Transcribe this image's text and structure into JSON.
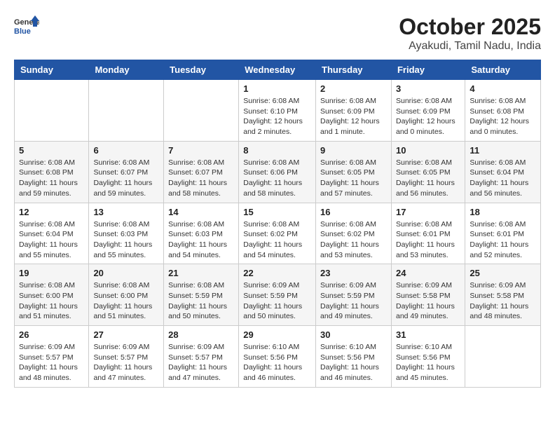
{
  "header": {
    "logo_general": "General",
    "logo_blue": "Blue",
    "month_title": "October 2025",
    "location": "Ayakudi, Tamil Nadu, India"
  },
  "days_of_week": [
    "Sunday",
    "Monday",
    "Tuesday",
    "Wednesday",
    "Thursday",
    "Friday",
    "Saturday"
  ],
  "weeks": [
    [
      {
        "day": "",
        "info": ""
      },
      {
        "day": "",
        "info": ""
      },
      {
        "day": "",
        "info": ""
      },
      {
        "day": "1",
        "info": "Sunrise: 6:08 AM\nSunset: 6:10 PM\nDaylight: 12 hours\nand 2 minutes."
      },
      {
        "day": "2",
        "info": "Sunrise: 6:08 AM\nSunset: 6:09 PM\nDaylight: 12 hours\nand 1 minute."
      },
      {
        "day": "3",
        "info": "Sunrise: 6:08 AM\nSunset: 6:09 PM\nDaylight: 12 hours\nand 0 minutes."
      },
      {
        "day": "4",
        "info": "Sunrise: 6:08 AM\nSunset: 6:08 PM\nDaylight: 12 hours\nand 0 minutes."
      }
    ],
    [
      {
        "day": "5",
        "info": "Sunrise: 6:08 AM\nSunset: 6:08 PM\nDaylight: 11 hours\nand 59 minutes."
      },
      {
        "day": "6",
        "info": "Sunrise: 6:08 AM\nSunset: 6:07 PM\nDaylight: 11 hours\nand 59 minutes."
      },
      {
        "day": "7",
        "info": "Sunrise: 6:08 AM\nSunset: 6:07 PM\nDaylight: 11 hours\nand 58 minutes."
      },
      {
        "day": "8",
        "info": "Sunrise: 6:08 AM\nSunset: 6:06 PM\nDaylight: 11 hours\nand 58 minutes."
      },
      {
        "day": "9",
        "info": "Sunrise: 6:08 AM\nSunset: 6:05 PM\nDaylight: 11 hours\nand 57 minutes."
      },
      {
        "day": "10",
        "info": "Sunrise: 6:08 AM\nSunset: 6:05 PM\nDaylight: 11 hours\nand 56 minutes."
      },
      {
        "day": "11",
        "info": "Sunrise: 6:08 AM\nSunset: 6:04 PM\nDaylight: 11 hours\nand 56 minutes."
      }
    ],
    [
      {
        "day": "12",
        "info": "Sunrise: 6:08 AM\nSunset: 6:04 PM\nDaylight: 11 hours\nand 55 minutes."
      },
      {
        "day": "13",
        "info": "Sunrise: 6:08 AM\nSunset: 6:03 PM\nDaylight: 11 hours\nand 55 minutes."
      },
      {
        "day": "14",
        "info": "Sunrise: 6:08 AM\nSunset: 6:03 PM\nDaylight: 11 hours\nand 54 minutes."
      },
      {
        "day": "15",
        "info": "Sunrise: 6:08 AM\nSunset: 6:02 PM\nDaylight: 11 hours\nand 54 minutes."
      },
      {
        "day": "16",
        "info": "Sunrise: 6:08 AM\nSunset: 6:02 PM\nDaylight: 11 hours\nand 53 minutes."
      },
      {
        "day": "17",
        "info": "Sunrise: 6:08 AM\nSunset: 6:01 PM\nDaylight: 11 hours\nand 53 minutes."
      },
      {
        "day": "18",
        "info": "Sunrise: 6:08 AM\nSunset: 6:01 PM\nDaylight: 11 hours\nand 52 minutes."
      }
    ],
    [
      {
        "day": "19",
        "info": "Sunrise: 6:08 AM\nSunset: 6:00 PM\nDaylight: 11 hours\nand 51 minutes."
      },
      {
        "day": "20",
        "info": "Sunrise: 6:08 AM\nSunset: 6:00 PM\nDaylight: 11 hours\nand 51 minutes."
      },
      {
        "day": "21",
        "info": "Sunrise: 6:08 AM\nSunset: 5:59 PM\nDaylight: 11 hours\nand 50 minutes."
      },
      {
        "day": "22",
        "info": "Sunrise: 6:09 AM\nSunset: 5:59 PM\nDaylight: 11 hours\nand 50 minutes."
      },
      {
        "day": "23",
        "info": "Sunrise: 6:09 AM\nSunset: 5:59 PM\nDaylight: 11 hours\nand 49 minutes."
      },
      {
        "day": "24",
        "info": "Sunrise: 6:09 AM\nSunset: 5:58 PM\nDaylight: 11 hours\nand 49 minutes."
      },
      {
        "day": "25",
        "info": "Sunrise: 6:09 AM\nSunset: 5:58 PM\nDaylight: 11 hours\nand 48 minutes."
      }
    ],
    [
      {
        "day": "26",
        "info": "Sunrise: 6:09 AM\nSunset: 5:57 PM\nDaylight: 11 hours\nand 48 minutes."
      },
      {
        "day": "27",
        "info": "Sunrise: 6:09 AM\nSunset: 5:57 PM\nDaylight: 11 hours\nand 47 minutes."
      },
      {
        "day": "28",
        "info": "Sunrise: 6:09 AM\nSunset: 5:57 PM\nDaylight: 11 hours\nand 47 minutes."
      },
      {
        "day": "29",
        "info": "Sunrise: 6:10 AM\nSunset: 5:56 PM\nDaylight: 11 hours\nand 46 minutes."
      },
      {
        "day": "30",
        "info": "Sunrise: 6:10 AM\nSunset: 5:56 PM\nDaylight: 11 hours\nand 46 minutes."
      },
      {
        "day": "31",
        "info": "Sunrise: 6:10 AM\nSunset: 5:56 PM\nDaylight: 11 hours\nand 45 minutes."
      },
      {
        "day": "",
        "info": ""
      }
    ]
  ]
}
